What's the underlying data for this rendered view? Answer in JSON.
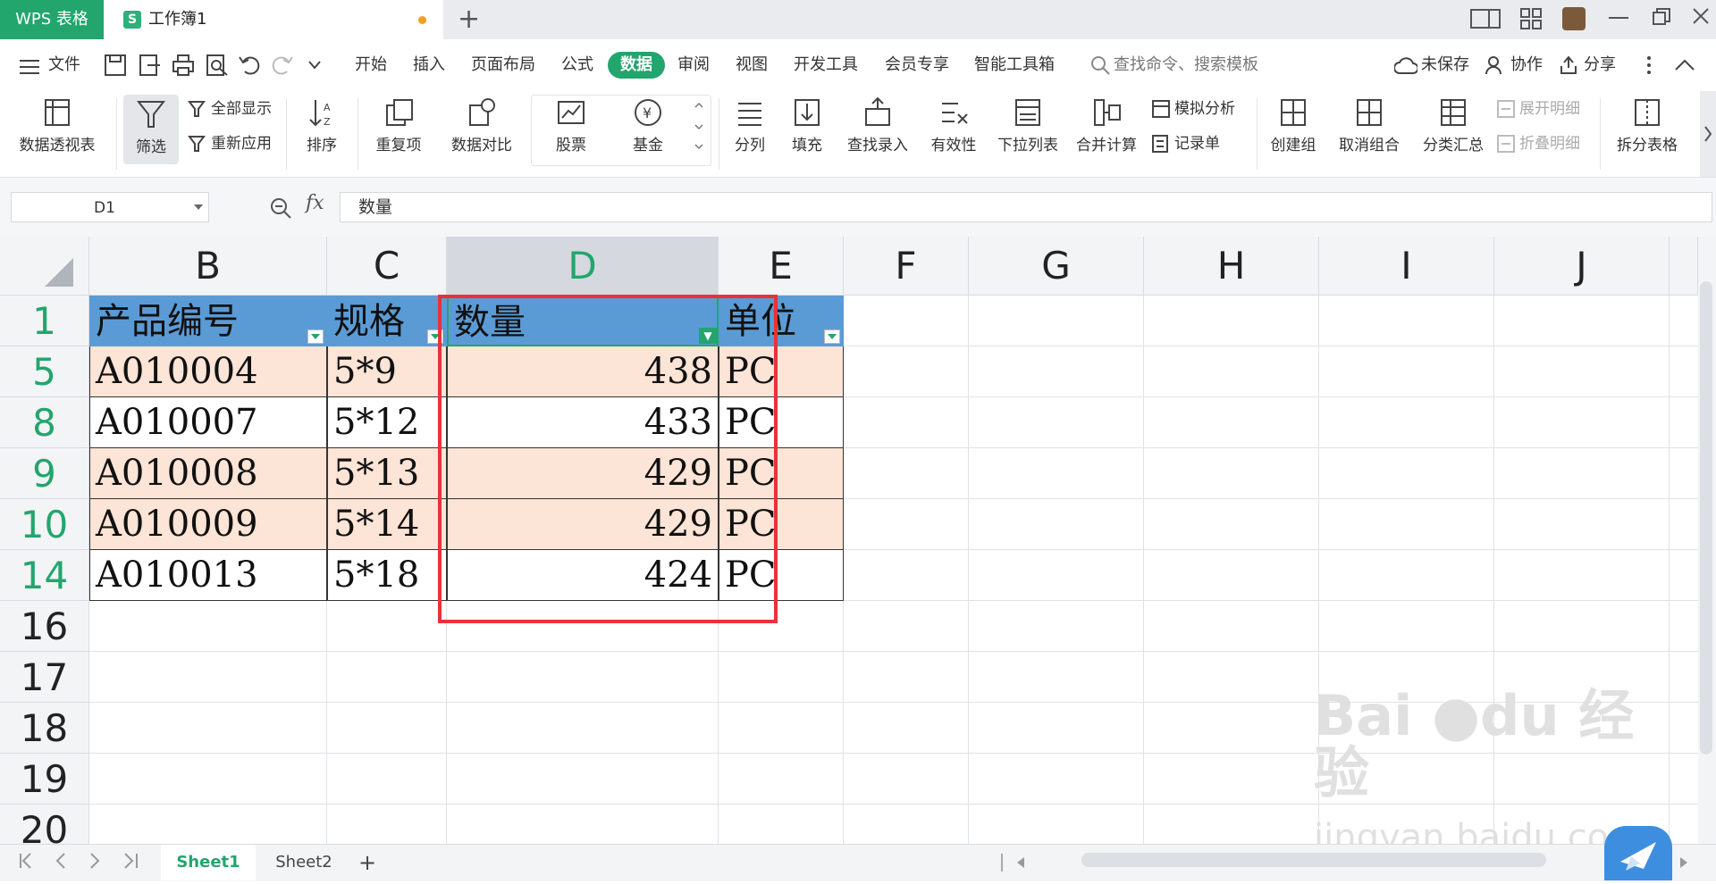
{
  "tabs": {
    "app_label": "WPS 表格",
    "doc_icon": "S",
    "doc_title": "工作簿1",
    "new_tab": "+"
  },
  "menu": {
    "file": "文件",
    "items": [
      "开始",
      "插入",
      "页面布局",
      "公式",
      "数据",
      "审阅",
      "视图",
      "开发工具",
      "会员专享",
      "智能工具箱"
    ],
    "active": "数据",
    "search": "查找命令、搜索模板",
    "unsaved": "未保存",
    "collab": "协作",
    "share": "分享"
  },
  "ribbon": {
    "pivot": "数据透视表",
    "filter": "筛选",
    "show_all": "全部显示",
    "reapply": "重新应用",
    "sort": "排序",
    "duplicates": "重复项",
    "compare": "数据对比",
    "stocks": "股票",
    "funds": "基金",
    "split_col": "分列",
    "fill": "填充",
    "lookup": "查找录入",
    "validity": "有效性",
    "dropdown": "下拉列表",
    "consolidate": "合并计算",
    "simulate": "模拟分析",
    "record": "记录单",
    "group": "创建组",
    "ungroup": "取消组合",
    "subtotal": "分类汇总",
    "expand": "展开明细",
    "collapse": "折叠明细",
    "split_table": "拆分表格"
  },
  "formula_bar": {
    "cell_ref": "D1",
    "fx": "fx",
    "content": "数量"
  },
  "grid": {
    "columns": [
      "B",
      "C",
      "D",
      "E",
      "F",
      "G",
      "H",
      "I",
      "J"
    ],
    "selected_column": "D",
    "rows": [
      "1",
      "5",
      "8",
      "9",
      "10",
      "14",
      "16",
      "17",
      "18",
      "19",
      "20"
    ],
    "header": [
      "产品编号",
      "规格",
      "数量",
      "单位"
    ],
    "data": [
      [
        "A010004",
        "5*9",
        "438",
        "PC"
      ],
      [
        "A010007",
        "5*12",
        "433",
        "PC"
      ],
      [
        "A010008",
        "5*13",
        "429",
        "PC"
      ],
      [
        "A010009",
        "5*14",
        "429",
        "PC"
      ],
      [
        "A010013",
        "5*18",
        "424",
        "PC"
      ]
    ]
  },
  "sheets": {
    "active": "Sheet1",
    "other": "Sheet2",
    "add": "+"
  },
  "watermark": {
    "brand": "Bai",
    "brand_suffix": "经验",
    "url": "jingyan.baidu.com"
  },
  "colors": {
    "accent": "#23a56e",
    "header_fill": "#5b9bd5",
    "band_fill": "#fce4d6",
    "highlight_box": "#e8323a"
  }
}
